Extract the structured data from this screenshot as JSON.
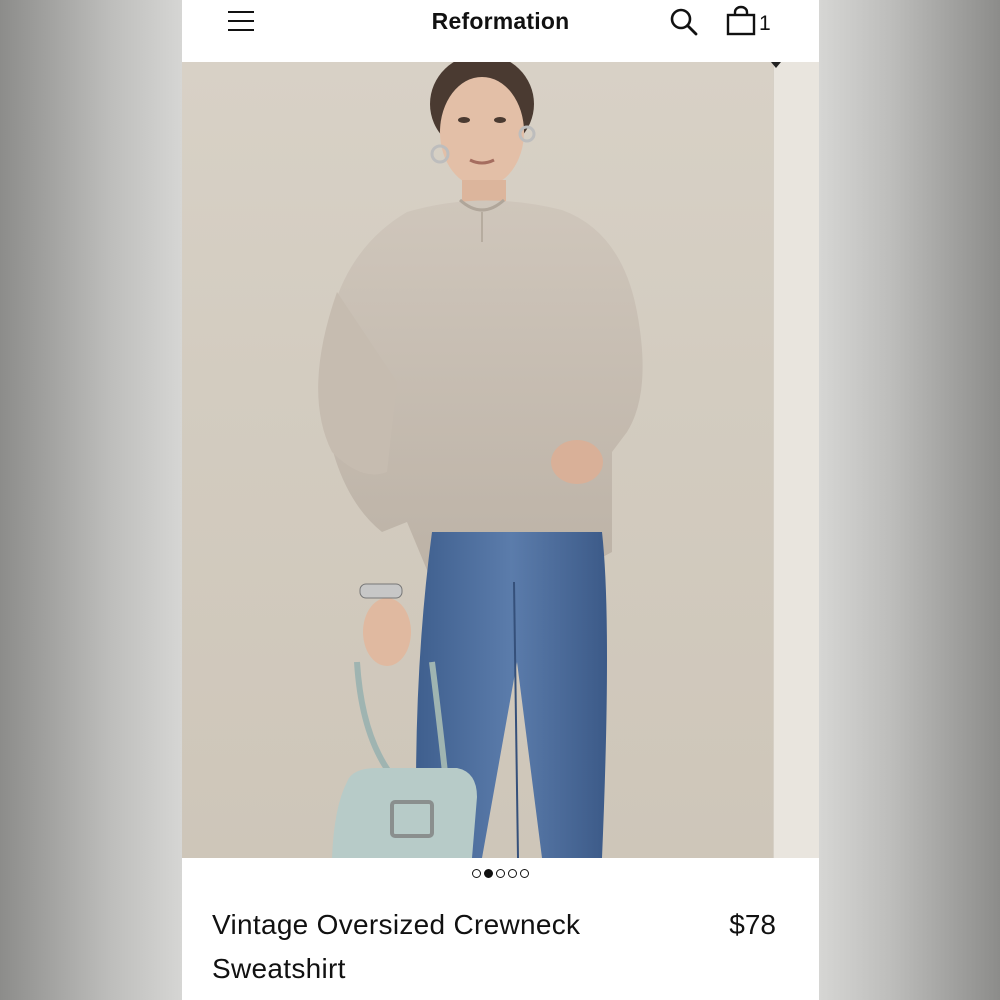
{
  "header": {
    "brand": "Reformation",
    "bag_count": "1",
    "icons": [
      "menu-icon",
      "search-icon",
      "shopping-bag-icon"
    ]
  },
  "carousel": {
    "total": 5,
    "active_index": 1
  },
  "product": {
    "title": "Vintage Oversized Crewneck Sweatshirt",
    "price": "$78"
  },
  "colors": {
    "background": "#ffffff",
    "text": "#111111",
    "sweatshirt": "#c8bfb3",
    "denim": "#4d6e9c",
    "bag": "#b7cbc8"
  }
}
